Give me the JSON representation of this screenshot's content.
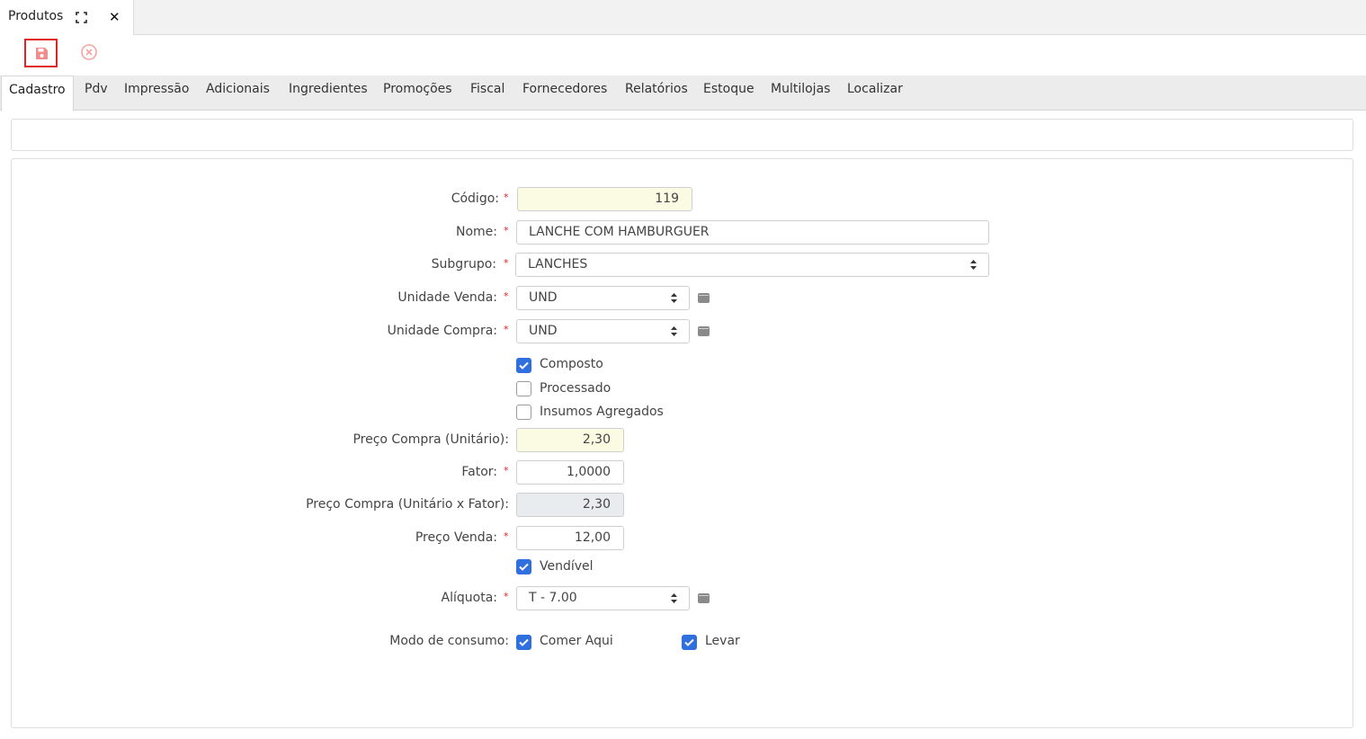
{
  "window_tab": {
    "title": "Produtos"
  },
  "form_tabs": [
    "Cadastro",
    "Pdv",
    "Impressão",
    "Adicionais",
    "Ingredientes",
    "Promoções",
    "Fiscal",
    "Fornecedores",
    "Relatórios",
    "Estoque",
    "Multilojas",
    "Localizar"
  ],
  "fields": {
    "codigo": {
      "label": "Código:",
      "value": "119"
    },
    "nome": {
      "label": "Nome:",
      "value": "LANCHE COM HAMBURGUER"
    },
    "subgrupo": {
      "label": "Subgrupo:",
      "value": "LANCHES"
    },
    "unidade_venda": {
      "label": "Unidade Venda:",
      "value": "UND"
    },
    "unidade_compra": {
      "label": "Unidade Compra:",
      "value": "UND"
    },
    "preco_compra": {
      "label": "Preço Compra (Unitário):",
      "value": "2,30"
    },
    "fator": {
      "label": "Fator:",
      "value": "1,0000"
    },
    "preco_compra_fator": {
      "label": "Preço Compra (Unitário x Fator):",
      "value": "2,30"
    },
    "preco_venda": {
      "label": "Preço Venda:",
      "value": "12,00"
    },
    "aliquota": {
      "label": "Alíquota:",
      "value": "T - 7.00"
    }
  },
  "checkboxes": {
    "composto": {
      "label": "Composto",
      "checked": true
    },
    "processado": {
      "label": "Processado",
      "checked": false
    },
    "insumos_agregados": {
      "label": "Insumos Agregados",
      "checked": false
    },
    "vendivel": {
      "label": "Vendível",
      "checked": true
    }
  },
  "modo_consumo": {
    "label": "Modo de consumo:",
    "comer_aqui": {
      "label": "Comer Aqui",
      "checked": true
    },
    "levar": {
      "label": "Levar",
      "checked": true
    }
  },
  "required_mark": "*",
  "colors": {
    "accent": "#2f6fde",
    "required": "#e02424",
    "highlight_field": "#fbfbe3",
    "disabled_field": "#e9ecef"
  },
  "icons": {
    "save": "save-icon",
    "cancel": "cancel-icon",
    "expand": "expand-icon",
    "close": "close-icon"
  }
}
